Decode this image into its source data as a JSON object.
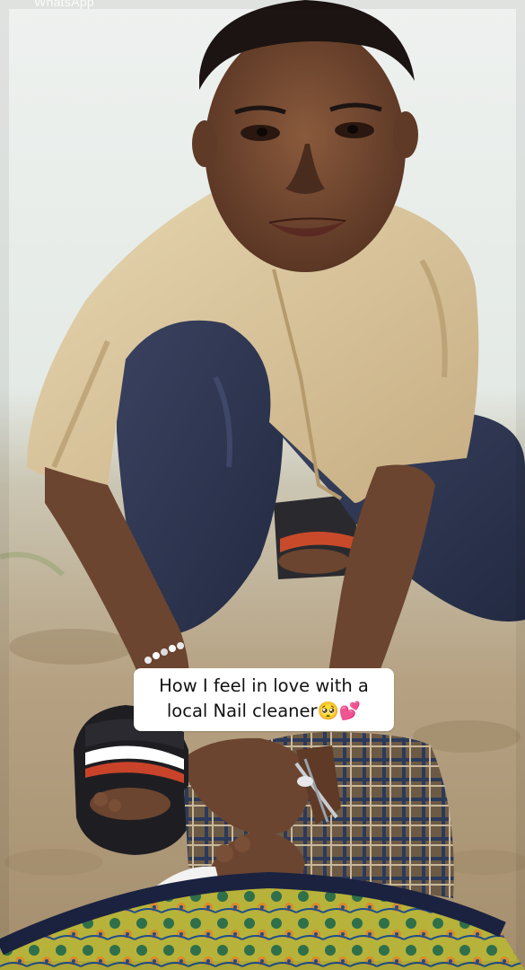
{
  "watermark": {
    "text": "WhatsApp"
  },
  "caption": {
    "line1": "How I feel in love with a",
    "line2": "local Nail cleaner🥺💕"
  },
  "colors": {
    "sky": "#eef1ef",
    "ground": "#b09a78",
    "skin": "#6b4530",
    "shirt": "#d9c7a0",
    "pants": "#2d3550",
    "caption_bg": "#ffffff",
    "caption_text": "#111111"
  }
}
